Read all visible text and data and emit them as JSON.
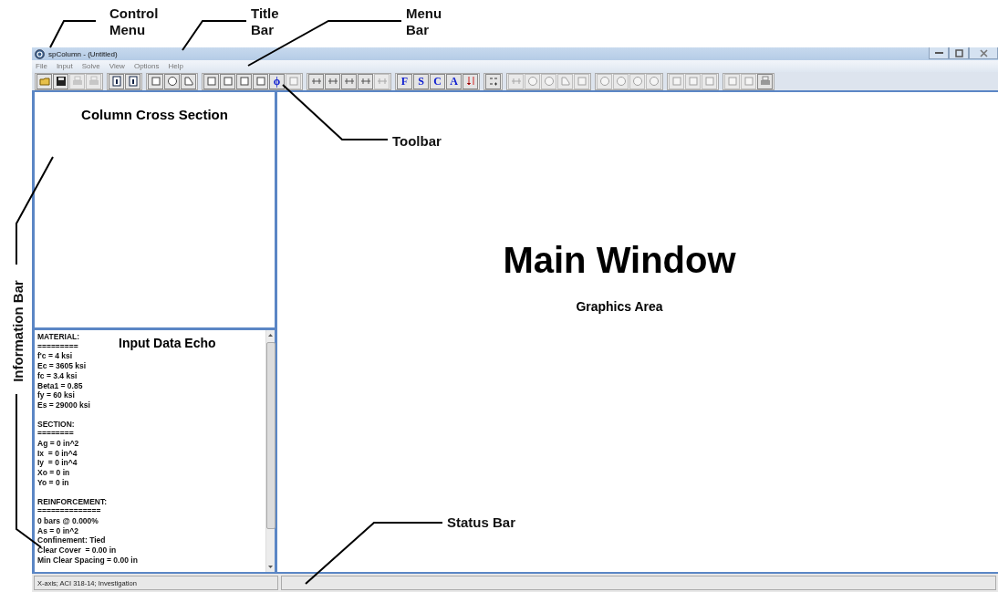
{
  "window": {
    "title": "spColumn - (Untitled)"
  },
  "menu_bar": [
    "File",
    "Input",
    "Solve",
    "View",
    "Options",
    "Help"
  ],
  "toolbar": [
    [
      {
        "kind": "open",
        "disabled": false
      },
      {
        "kind": "save",
        "disabled": false
      },
      {
        "kind": "print",
        "disabled": true
      },
      {
        "kind": "print",
        "disabled": true
      }
    ],
    [
      {
        "kind": "info",
        "disabled": false
      },
      {
        "kind": "info",
        "disabled": false
      }
    ],
    [
      {
        "kind": "rect",
        "disabled": false
      },
      {
        "kind": "circle",
        "disabled": false
      },
      {
        "kind": "irregular",
        "disabled": false
      }
    ],
    [
      {
        "kind": "rect",
        "disabled": false
      },
      {
        "kind": "rect",
        "disabled": false
      },
      {
        "kind": "rect",
        "disabled": false
      },
      {
        "kind": "rect",
        "disabled": false
      },
      {
        "kind": "letter",
        "label": "ϕ",
        "disabled": false
      },
      {
        "kind": "rect",
        "disabled": true
      }
    ],
    [
      {
        "kind": "bars",
        "disabled": false
      },
      {
        "kind": "bars",
        "disabled": false
      },
      {
        "kind": "bars",
        "disabled": false
      },
      {
        "kind": "bars",
        "disabled": false
      },
      {
        "kind": "bars",
        "disabled": true
      }
    ],
    [
      {
        "kind": "letter",
        "label": "F",
        "disabled": false
      },
      {
        "kind": "letter",
        "label": "S",
        "disabled": false
      },
      {
        "kind": "letter",
        "label": "C",
        "disabled": false
      },
      {
        "kind": "letter",
        "label": "A",
        "disabled": false
      },
      {
        "kind": "arrows",
        "disabled": false
      }
    ],
    [
      {
        "kind": "grid",
        "disabled": false
      }
    ],
    [
      {
        "kind": "bars",
        "disabled": true
      },
      {
        "kind": "circle",
        "disabled": true
      },
      {
        "kind": "circle",
        "disabled": true
      },
      {
        "kind": "irregular",
        "disabled": true
      },
      {
        "kind": "rect",
        "disabled": true
      }
    ],
    [
      {
        "kind": "circle",
        "disabled": true
      },
      {
        "kind": "circle",
        "disabled": true
      },
      {
        "kind": "circle",
        "disabled": true
      },
      {
        "kind": "circle",
        "disabled": true
      }
    ],
    [
      {
        "kind": "rect",
        "disabled": true
      },
      {
        "kind": "rect",
        "disabled": true
      },
      {
        "kind": "rect",
        "disabled": true
      }
    ],
    [
      {
        "kind": "rect",
        "disabled": true
      },
      {
        "kind": "rect",
        "disabled": true
      },
      {
        "kind": "print",
        "disabled": false
      }
    ]
  ],
  "cross_section_panel": {
    "title": "Column Cross Section"
  },
  "echo_panel": {
    "title": "Input Data Echo",
    "sections": [
      {
        "heading": "MATERIAL:",
        "rule": "=========",
        "lines": [
          "f'c = 4 ksi",
          "Ec = 3605 ksi",
          "fc = 3.4 ksi",
          "Beta1 = 0.85",
          "fy = 60 ksi",
          "Es = 29000 ksi"
        ]
      },
      {
        "heading": "SECTION:",
        "rule": "========",
        "lines": [
          "Ag = 0 in^2",
          "Ix  = 0 in^4",
          "Iy  = 0 in^4",
          "Xo = 0 in",
          "Yo = 0 in"
        ]
      },
      {
        "heading": "REINFORCEMENT:",
        "rule": "==============",
        "lines": [
          "0 bars @ 0.000%",
          "As = 0 in^2",
          "Confinement: Tied",
          "Clear Cover  = 0.00 in",
          "Min Clear Spacing = 0.00 in"
        ]
      }
    ]
  },
  "main_window": {
    "title": "Main Window",
    "subtitle": "Graphics Area"
  },
  "status_bar": [
    "X-axis; ACI 318-14; Investigation"
  ],
  "annotations": [
    "Control Menu",
    "Title Bar",
    "Menu Bar",
    "Toolbar",
    "Information Bar",
    "Status Bar"
  ]
}
